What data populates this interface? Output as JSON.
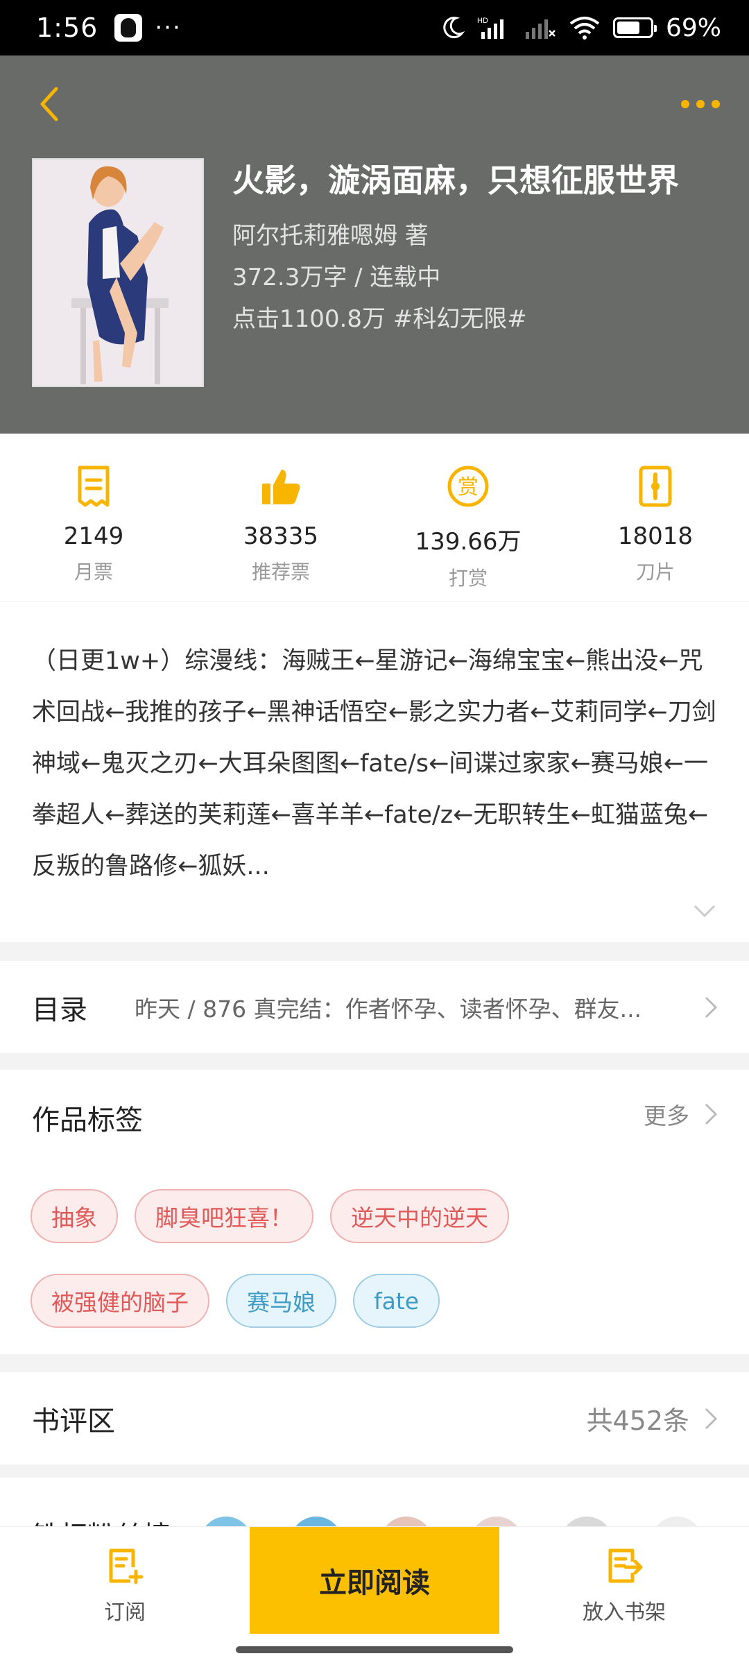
{
  "status_bar": {
    "time": "1:56",
    "dots": "···",
    "battery_text": "69%",
    "battery_level": 0.69
  },
  "colors": {
    "accent": "#f7b500",
    "header_bg": "#696b69",
    "read_button": "#fdc000",
    "tag_red": "#e05a5a",
    "tag_blue": "#3e9bc6"
  },
  "header": {
    "title": "火影，漩涡面麻，只想征服世界",
    "author": "阿尔托莉雅嗯姆  著",
    "words_status": "372.3万字 / 连载中",
    "clicks_category": "点击1100.8万  #科幻无限#"
  },
  "stats": [
    {
      "icon": "monthly-ticket-icon",
      "value": "2149",
      "label": "月票"
    },
    {
      "icon": "thumbs-up-icon",
      "value": "38335",
      "label": "推荐票"
    },
    {
      "icon": "reward-icon",
      "value": "139.66万",
      "label": "打赏"
    },
    {
      "icon": "blade-icon",
      "value": "18018",
      "label": "刀片"
    }
  ],
  "description": "（日更1w+）综漫线：海贼王←星游记←海绵宝宝←熊出没←咒术回战←我推的孩子←黑神话悟空←影之实力者←艾莉同学←刀剑神域←鬼灭之刃←大耳朵图图←fate/s←间谍过家家←赛马娘←一拳超人←葬送的芙莉莲←喜羊羊←fate/z←无职转生←虹猫蓝兔←反叛的鲁路修←狐妖...",
  "catalog": {
    "title": "目录",
    "info": "昨天 / 876 真完结：作者怀孕、读者怀孕、群友..."
  },
  "tags": {
    "title": "作品标签",
    "more": "更多",
    "row1": [
      "抽象",
      "脚臭吧狂喜！",
      "逆天中的逆天"
    ],
    "row2_red": [
      "被强健的脑子"
    ],
    "row2_blue": [
      "赛马娘",
      "fate"
    ]
  },
  "reviews": {
    "title": "书评区",
    "count": "共452条"
  },
  "fans": {
    "title": "铁杆粉丝榜"
  },
  "bottom": {
    "subscribe": "订阅",
    "read_now": "立即阅读",
    "add_shelf": "放入书架"
  }
}
